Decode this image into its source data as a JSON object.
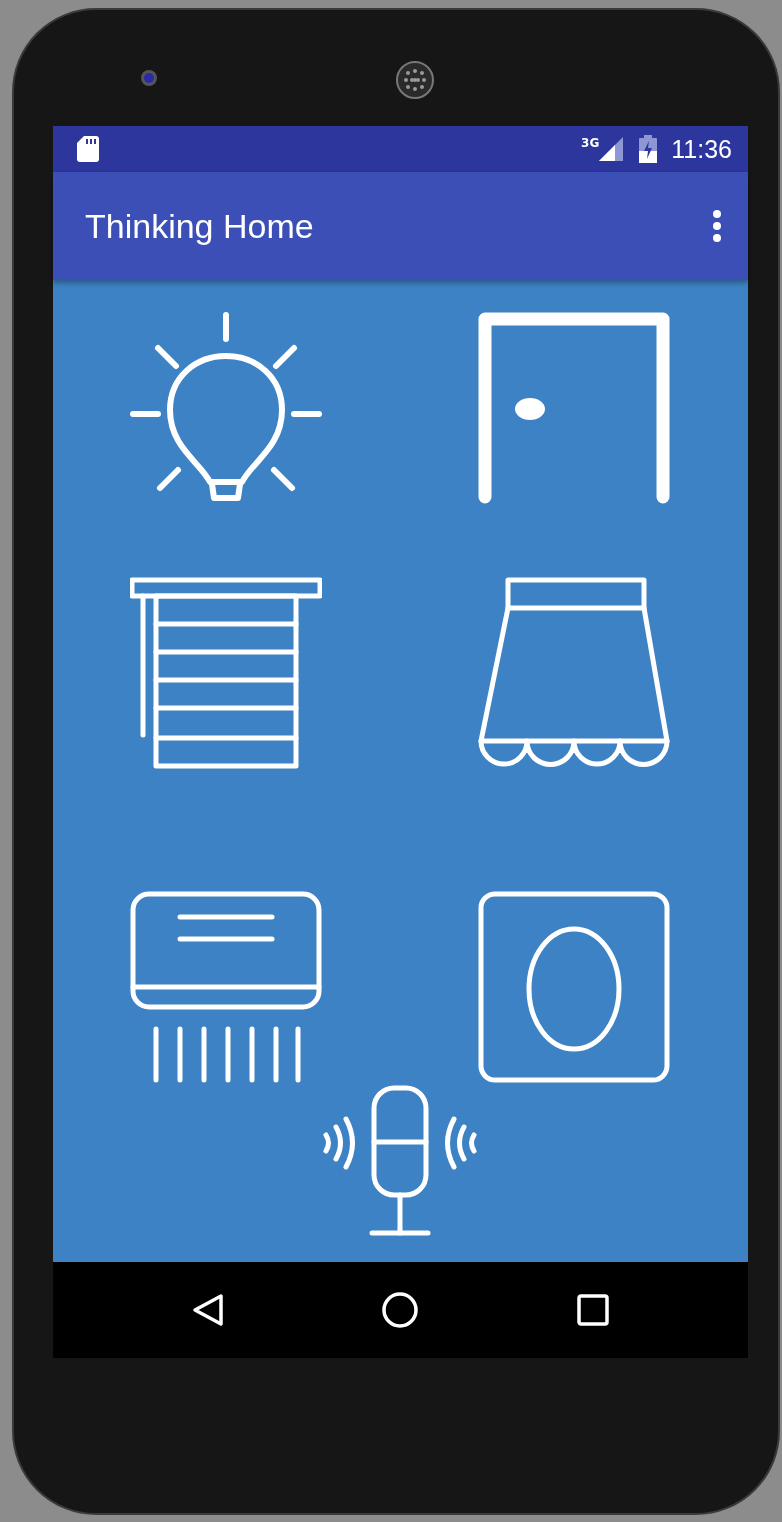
{
  "status_bar": {
    "network": "3G",
    "time": "11:36"
  },
  "app_bar": {
    "title": "Thinking Home"
  },
  "tiles": [
    {
      "kind": "light"
    },
    {
      "kind": "door"
    },
    {
      "kind": "blinds"
    },
    {
      "kind": "awning"
    },
    {
      "kind": "ac"
    },
    {
      "kind": "switch"
    }
  ],
  "voice": {
    "kind": "voice"
  }
}
